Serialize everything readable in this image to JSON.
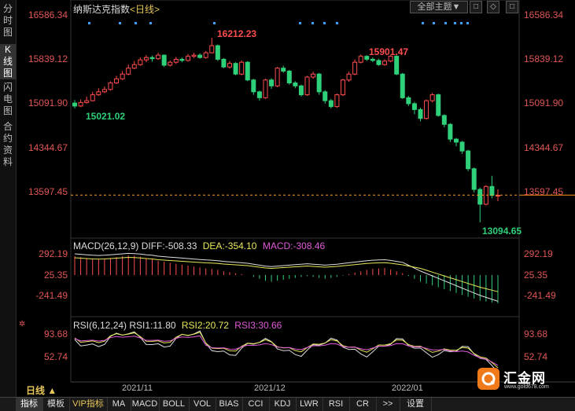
{
  "instrument": {
    "name": "纳斯达克指数",
    "period_tag": "<日线>"
  },
  "left_tabs": [
    {
      "label": "分时图"
    },
    {
      "label": "K线图"
    },
    {
      "label": "闪电图"
    },
    {
      "label": "合约资料"
    }
  ],
  "toolbar": {
    "all_topics": "全部主题▼",
    "btn1": "□",
    "btn2": "◇",
    "btn3": "□"
  },
  "price_axis": [
    "16586.34",
    "15839.12",
    "15091.90",
    "14344.67",
    "13597.45"
  ],
  "annotations": {
    "high1": "16212.23",
    "high2": "15901.47",
    "low1": "15021.02",
    "low2": "13094.65"
  },
  "macd": {
    "title": "MACD(26,12,9)",
    "diff": "DIFF:-508.33",
    "dea": "DEA:-354.10",
    "macd": "MACD:-308.46",
    "axis": [
      "292.19",
      "25.35",
      "-241.49"
    ]
  },
  "rsi": {
    "title": "RSI(6,12,24)",
    "rsi1": "RSI1:11.80",
    "rsi2": "RSI2:20.72",
    "rsi3": "RSI3:30.66",
    "axis": [
      "93.68",
      "52.74"
    ]
  },
  "dates": [
    "2021/11",
    "2021/12",
    "2022/01"
  ],
  "period_button": "日线 ▲",
  "bottom_tabs": [
    "指标",
    "模板",
    "VIP指标",
    "MA",
    "MACD",
    "BOLL",
    "VOL",
    "BIAS",
    "CCI",
    "KDJ",
    "LWR",
    "RSI",
    "CR",
    ">>",
    "设置"
  ],
  "logo": {
    "name": "汇金网",
    "url": "www.gold678.com"
  },
  "colors": {
    "up": "#ff4d4d",
    "down": "#2fd07a",
    "dea": "#e8e85a",
    "macd_purple": "#e05ad8",
    "bg": "#000000"
  },
  "chart_data": {
    "type": "candlestick",
    "candles": [
      [
        15110,
        15060,
        15160,
        15020
      ],
      [
        15060,
        15120,
        15170,
        15040
      ],
      [
        15120,
        15150,
        15220,
        15100
      ],
      [
        15150,
        15250,
        15300,
        15140
      ],
      [
        15250,
        15300,
        15360,
        15230
      ],
      [
        15300,
        15340,
        15390,
        15280
      ],
      [
        15340,
        15450,
        15480,
        15320
      ],
      [
        15450,
        15520,
        15570,
        15430
      ],
      [
        15520,
        15600,
        15650,
        15500
      ],
      [
        15600,
        15700,
        15760,
        15580
      ],
      [
        15700,
        15760,
        15820,
        15680
      ],
      [
        15760,
        15840,
        15880,
        15740
      ],
      [
        15840,
        15880,
        15920,
        15800
      ],
      [
        15880,
        15860,
        15910,
        15810
      ],
      [
        15860,
        15920,
        15960,
        15840
      ],
      [
        15920,
        15750,
        15930,
        15720
      ],
      [
        15750,
        15800,
        15830,
        15730
      ],
      [
        15800,
        15850,
        15890,
        15770
      ],
      [
        15850,
        15830,
        15880,
        15800
      ],
      [
        15830,
        15900,
        15940,
        15810
      ],
      [
        15900,
        15920,
        15960,
        15870
      ],
      [
        15920,
        15880,
        15950,
        15860
      ],
      [
        15880,
        15960,
        15990,
        15860
      ],
      [
        15960,
        16080,
        16212,
        15950
      ],
      [
        16080,
        15850,
        16100,
        15820
      ],
      [
        15850,
        15720,
        15870,
        15700
      ],
      [
        15720,
        15780,
        15820,
        15690
      ],
      [
        15780,
        15600,
        15800,
        15580
      ],
      [
        15600,
        15800,
        15830,
        15580
      ],
      [
        15800,
        15500,
        15820,
        15480
      ],
      [
        15500,
        15300,
        15520,
        15250
      ],
      [
        15300,
        15200,
        15320,
        15150
      ],
      [
        15200,
        15500,
        15520,
        15180
      ],
      [
        15500,
        15400,
        15530,
        15350
      ],
      [
        15400,
        15700,
        15720,
        15380
      ],
      [
        15700,
        15650,
        15740,
        15620
      ],
      [
        15650,
        15450,
        15670,
        15420
      ],
      [
        15450,
        15400,
        15480,
        15360
      ],
      [
        15400,
        15250,
        15420,
        15220
      ],
      [
        15250,
        15550,
        15570,
        15230
      ],
      [
        15550,
        15600,
        15640,
        15520
      ],
      [
        15600,
        15300,
        15620,
        15250
      ],
      [
        15300,
        15150,
        15330,
        15100
      ],
      [
        15150,
        15050,
        15180,
        15021
      ],
      [
        15050,
        15250,
        15270,
        15030
      ],
      [
        15250,
        15500,
        15520,
        15230
      ],
      [
        15500,
        15600,
        15640,
        15470
      ],
      [
        15600,
        15800,
        15850,
        15580
      ],
      [
        15800,
        15900,
        15930,
        15780
      ],
      [
        15900,
        15850,
        15920,
        15820
      ],
      [
        15850,
        15830,
        15880,
        15800
      ],
      [
        15830,
        15760,
        15860,
        15740
      ],
      [
        15760,
        15820,
        15850,
        15740
      ],
      [
        15820,
        15901,
        15920,
        15800
      ],
      [
        15901,
        15600,
        15920,
        15580
      ],
      [
        15600,
        15200,
        15620,
        15180
      ],
      [
        15200,
        15100,
        15230,
        15060
      ],
      [
        15100,
        15000,
        15130,
        14920
      ],
      [
        15000,
        14850,
        15030,
        14800
      ],
      [
        14850,
        15150,
        15170,
        14830
      ],
      [
        15150,
        15250,
        15280,
        15120
      ],
      [
        15250,
        14900,
        15270,
        14880
      ],
      [
        14900,
        14750,
        14920,
        14700
      ],
      [
        14750,
        14500,
        14770,
        14450
      ],
      [
        14500,
        14450,
        14520,
        14380
      ],
      [
        14450,
        14300,
        14470,
        14250
      ],
      [
        14300,
        14000,
        14320,
        13960
      ],
      [
        14000,
        13650,
        14020,
        13600
      ],
      [
        13650,
        13400,
        13680,
        13094
      ],
      [
        13400,
        13700,
        13720,
        13380
      ],
      [
        13700,
        13550,
        13880,
        13500
      ],
      [
        13550,
        13550,
        13650,
        13450
      ]
    ],
    "price_axis": [
      16586.34,
      15839.12,
      15091.9,
      14344.67,
      13597.45
    ],
    "current_price_line": 13555,
    "high_marks": [
      16212.23,
      15901.47
    ],
    "low_marks": [
      15021.02,
      13094.65
    ],
    "macd_axis": [
      292.19,
      25.35,
      -241.49
    ],
    "macd_values": [
      200,
      190,
      180,
      170,
      165,
      170,
      180,
      190,
      200,
      210,
      205,
      195,
      180,
      170,
      150,
      140,
      130,
      120,
      110,
      100,
      90,
      80,
      70,
      65,
      55,
      40,
      30,
      20,
      10,
      0,
      -20,
      -40,
      -60,
      -70,
      -60,
      -50,
      -40,
      -30,
      -20,
      -10,
      -20,
      -30,
      -40,
      -30,
      -20,
      -5,
      10,
      25,
      40,
      55,
      65,
      70,
      75,
      60,
      40,
      20,
      -10,
      -40,
      -70,
      -90,
      -110,
      -130,
      -150,
      -170,
      -190,
      -210,
      -230,
      -250,
      -270,
      -280,
      -290,
      -300
    ],
    "rsi_axis": [
      93.68,
      52.74
    ]
  }
}
